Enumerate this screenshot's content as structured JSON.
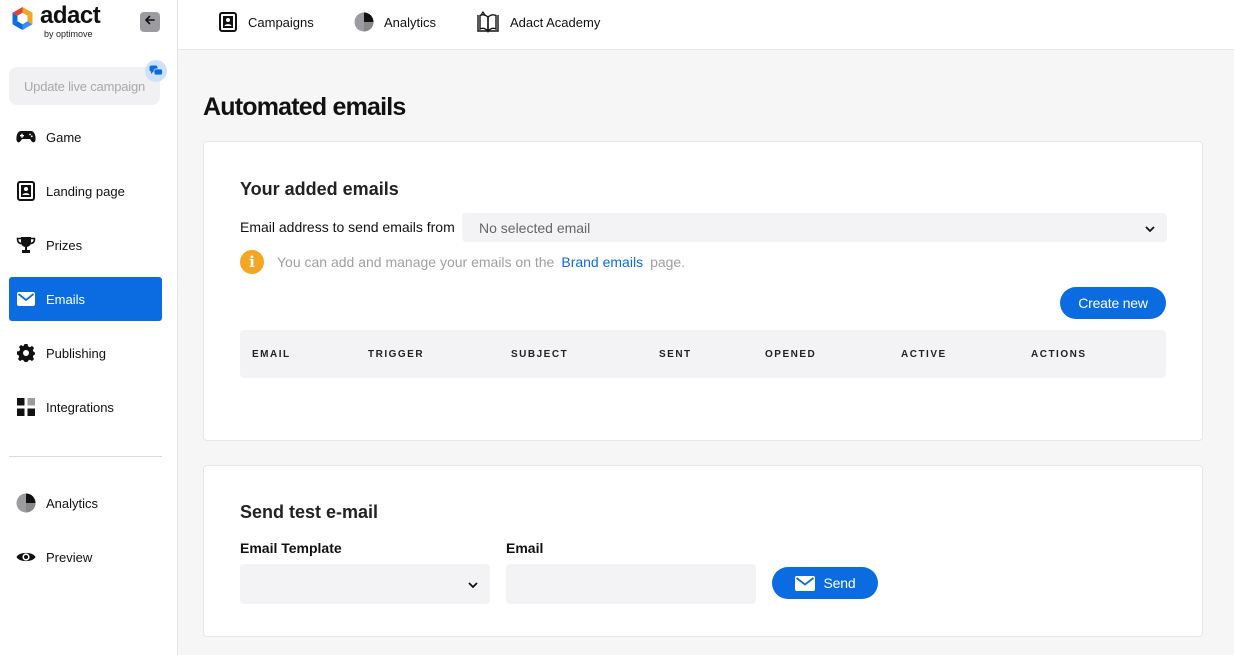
{
  "brand": {
    "name": "adact",
    "byline": "by optimove"
  },
  "sidebar": {
    "update_button": "Update live campaign",
    "items": [
      {
        "label": "Game",
        "icon": "gamepad-icon"
      },
      {
        "label": "Landing page",
        "icon": "landing-page-icon"
      },
      {
        "label": "Prizes",
        "icon": "trophy-icon"
      },
      {
        "label": "Emails",
        "icon": "envelope-icon",
        "active": true
      },
      {
        "label": "Publishing",
        "icon": "gear-icon"
      },
      {
        "label": "Integrations",
        "icon": "integrations-icon"
      }
    ],
    "secondary": [
      {
        "label": "Analytics",
        "icon": "pie-chart-icon"
      },
      {
        "label": "Preview",
        "icon": "eye-icon"
      }
    ]
  },
  "topbar": {
    "items": [
      {
        "label": "Campaigns",
        "icon": "campaigns-icon"
      },
      {
        "label": "Analytics",
        "icon": "pie-chart-icon"
      },
      {
        "label": "Adact Academy",
        "icon": "book-icon"
      }
    ]
  },
  "page": {
    "title": "Automated emails"
  },
  "added_emails": {
    "title": "Your added emails",
    "from_label": "Email address to send emails from",
    "from_value": "No selected email",
    "info_prefix": "You can add and manage your emails on the",
    "info_link": "Brand emails",
    "info_suffix": "page.",
    "create_button": "Create new",
    "columns": [
      "EMAIL",
      "TRIGGER",
      "SUBJECT",
      "SENT",
      "OPENED",
      "ACTIVE",
      "ACTIONS"
    ]
  },
  "test_email": {
    "title": "Send test e-mail",
    "template_label": "Email Template",
    "template_value": "",
    "email_label": "Email",
    "email_value": "",
    "send_button": "Send"
  },
  "colors": {
    "accent": "#0a6ce0",
    "warning": "#f5a524"
  }
}
